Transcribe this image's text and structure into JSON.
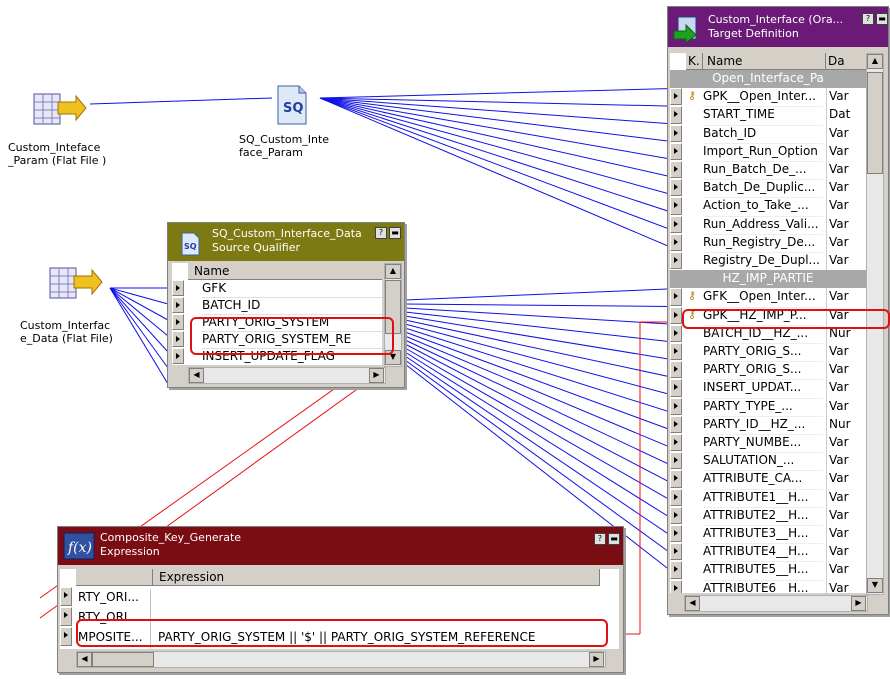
{
  "icons": {
    "param_file": {
      "name": "flat-file-icon",
      "label": "Custom_Inteface\n_Param (Flat File )"
    },
    "sq_param": {
      "name": "source-qualifier-icon",
      "label": "SQ_Custom_Inte\nface_Param"
    },
    "data_file": {
      "name": "flat-file-icon",
      "label": "Custom_Interfac\ne_Data (Flat File)"
    }
  },
  "sq_data": {
    "title": "SQ_Custom_Interface_Data",
    "subtitle": "Source Qualifier",
    "column_header": "Name",
    "rows": [
      "GFK",
      "BATCH_ID",
      "PARTY_ORIG_SYSTEM",
      "PARTY_ORIG_SYSTEM_RE",
      "INSERT_UPDATE_FLAG"
    ]
  },
  "expr": {
    "title": "Composite_Key_Generate",
    "subtitle": "Expression",
    "column_header": "Expression",
    "rows": [
      {
        "name": "RTY_ORI...",
        "expression": ""
      },
      {
        "name": "RTY_ORI...",
        "expression": ""
      },
      {
        "name": "MPOSITE...",
        "expression": "PARTY_ORIG_SYSTEM  || '$' || PARTY_ORIG_SYSTEM_REFERENCE"
      }
    ]
  },
  "target": {
    "title": "Custom_Interface (Ora...",
    "subtitle": "Target Definition",
    "headers": {
      "key": "K.",
      "name": "Name",
      "datatype": "Da"
    },
    "rows": [
      {
        "type": "group",
        "name": "Open_Interface_Pa"
      },
      {
        "key": true,
        "name": "GPK__Open_Inter...",
        "dt": "Var"
      },
      {
        "name": "START_TIME",
        "dt": "Dat"
      },
      {
        "name": "Batch_ID",
        "dt": "Var"
      },
      {
        "name": "Import_Run_Option",
        "dt": "Var"
      },
      {
        "name": "Run_Batch_De_...",
        "dt": "Var"
      },
      {
        "name": "Batch_De_Duplic...",
        "dt": "Var"
      },
      {
        "name": "Action_to_Take_...",
        "dt": "Var"
      },
      {
        "name": "Run_Address_Vali...",
        "dt": "Var"
      },
      {
        "name": "Run_Registry_De...",
        "dt": "Var"
      },
      {
        "name": "Registry_De_Dupl...",
        "dt": "Var"
      },
      {
        "type": "group",
        "name": "HZ_IMP_PARTIE"
      },
      {
        "key": true,
        "name": "GFK__Open_Inter...",
        "dt": "Var"
      },
      {
        "key": true,
        "name": "GPK__HZ_IMP_P...",
        "dt": "Var"
      },
      {
        "name": "BATCH_ID__HZ_...",
        "dt": "Nur"
      },
      {
        "name": "PARTY_ORIG_S...",
        "dt": "Var"
      },
      {
        "name": "PARTY_ORIG_S...",
        "dt": "Var"
      },
      {
        "name": "INSERT_UPDAT...",
        "dt": "Var"
      },
      {
        "name": "PARTY_TYPE_...",
        "dt": "Var"
      },
      {
        "name": "PARTY_ID__HZ_...",
        "dt": "Nur"
      },
      {
        "name": "PARTY_NUMBE...",
        "dt": "Var"
      },
      {
        "name": "SALUTATION_...",
        "dt": "Var"
      },
      {
        "name": "ATTRIBUTE_CA...",
        "dt": "Var"
      },
      {
        "name": "ATTRIBUTE1__H...",
        "dt": "Var"
      },
      {
        "name": "ATTRIBUTE2__H...",
        "dt": "Var"
      },
      {
        "name": "ATTRIBUTE3__H...",
        "dt": "Var"
      },
      {
        "name": "ATTRIBUTE4__H...",
        "dt": "Var"
      },
      {
        "name": "ATTRIBUTE5__H...",
        "dt": "Var"
      },
      {
        "name": "ATTRIBUTE6__H...",
        "dt": "Var"
      }
    ]
  },
  "buttons": {
    "help": "?",
    "minimize": "▬",
    "up": "▲",
    "down": "▼",
    "left": "◀",
    "right": "▶"
  }
}
